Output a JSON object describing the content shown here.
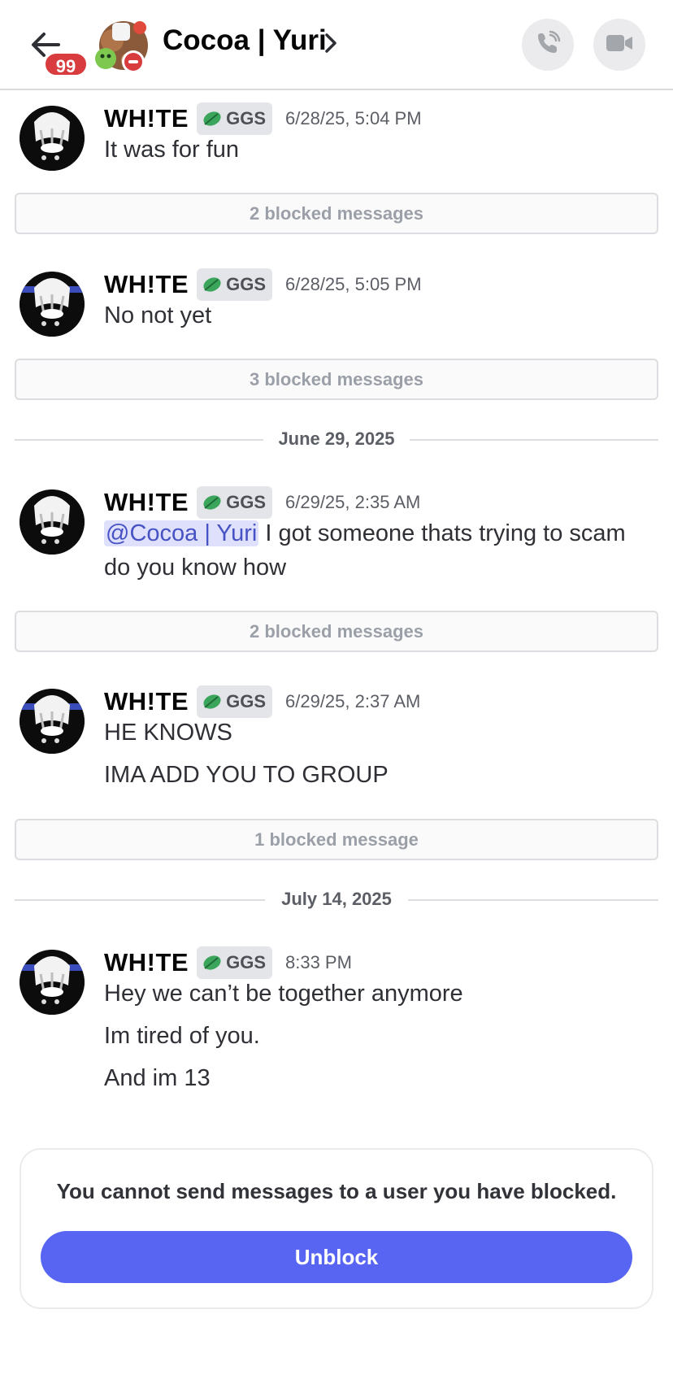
{
  "header": {
    "title": "Cocoa | Yuri",
    "unread_count": "99",
    "status": "do-not-disturb",
    "icons": [
      "back-arrow-icon",
      "chevron-right-icon",
      "phone-icon",
      "video-camera-icon"
    ]
  },
  "messages": [
    {
      "author": "WH!TE",
      "tag": "GGS",
      "time": "6/28/25, 5:04 PM",
      "lines": [
        "It was for fun"
      ]
    },
    {
      "author": "WH!TE",
      "tag": "GGS",
      "time": "6/28/25, 5:05 PM",
      "lines": [
        "No not yet"
      ]
    },
    {
      "author": "WH!TE",
      "tag": "GGS",
      "time": "6/29/25, 2:35 AM",
      "mention": "@Cocoa | Yuri",
      "lines": [
        " I got someone thats trying to scam",
        "do you know how"
      ]
    },
    {
      "author": "WH!TE",
      "tag": "GGS",
      "time": "6/29/25, 2:37 AM",
      "lines": [
        "HE KNOWS",
        "IMA ADD YOU TO GROUP"
      ]
    },
    {
      "author": "WH!TE",
      "tag": "GGS",
      "time": "8:33 PM",
      "lines": [
        "Hey we can’t be together anymore",
        "Im tired of you.",
        "And im 13"
      ]
    }
  ],
  "blocked": [
    "2 blocked messages",
    "3 blocked messages",
    "2 blocked messages",
    "1 blocked message"
  ],
  "dividers": [
    "June 29, 2025",
    "July 14, 2025"
  ],
  "notice": {
    "text": "You cannot send messages to a user you have blocked.",
    "button": "Unblock"
  },
  "colors": {
    "accent": "#5865f2",
    "badge": "#d83c3e",
    "mention_bg": "#dee0fc",
    "mention_text": "#4752c4",
    "tag_leaf": "#3ba55c"
  }
}
